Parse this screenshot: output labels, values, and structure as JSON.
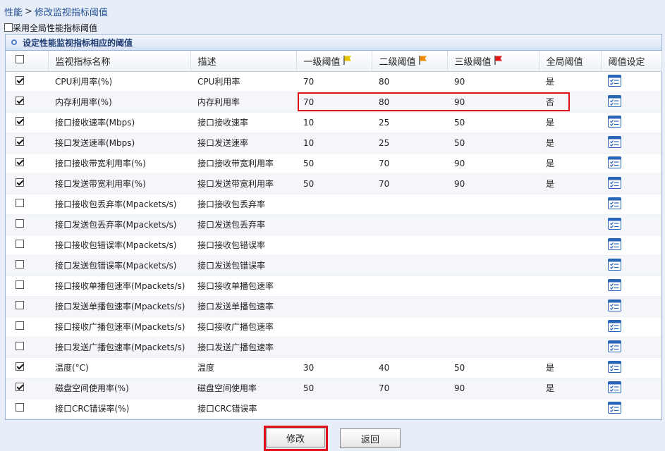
{
  "breadcrumb": {
    "root": "性能",
    "separator": ">",
    "current": "修改监视指标阈值"
  },
  "global_option": {
    "label": "采用全局性能指标阈值",
    "checked": false
  },
  "panel": {
    "title": "设定性能监视指标相应的阈值"
  },
  "table": {
    "headers": {
      "select": "",
      "name": "监视指标名称",
      "desc": "描述",
      "level1": "一级阈值",
      "level2": "二级阈值",
      "level3": "三级阈值",
      "global": "全局阈值",
      "setting": "阈值设定"
    },
    "flag_colors": {
      "level1": "#e8c400",
      "level2": "#f08a00",
      "level3": "#e01818"
    },
    "rows": [
      {
        "checked": true,
        "name": "CPU利用率(%)",
        "desc": "CPU利用率",
        "t1": "70",
        "t2": "80",
        "t3": "90",
        "global": "是"
      },
      {
        "checked": true,
        "name": "内存利用率(%)",
        "desc": "内存利用率",
        "t1": "70",
        "t2": "80",
        "t3": "90",
        "global": "否"
      },
      {
        "checked": true,
        "name": "接口接收速率(Mbps)",
        "desc": "接口接收速率",
        "t1": "10",
        "t2": "25",
        "t3": "50",
        "global": "是"
      },
      {
        "checked": true,
        "name": "接口发送速率(Mbps)",
        "desc": "接口发送速率",
        "t1": "10",
        "t2": "25",
        "t3": "50",
        "global": "是"
      },
      {
        "checked": true,
        "name": "接口接收带宽利用率(%)",
        "desc": "接口接收带宽利用率",
        "t1": "50",
        "t2": "70",
        "t3": "90",
        "global": "是"
      },
      {
        "checked": true,
        "name": "接口发送带宽利用率(%)",
        "desc": "接口发送带宽利用率",
        "t1": "50",
        "t2": "70",
        "t3": "90",
        "global": "是"
      },
      {
        "checked": false,
        "name": "接口接收包丢弃率(Mpackets/s)",
        "desc": "接口接收包丢弃率",
        "t1": "",
        "t2": "",
        "t3": "",
        "global": ""
      },
      {
        "checked": false,
        "name": "接口发送包丢弃率(Mpackets/s)",
        "desc": "接口发送包丢弃率",
        "t1": "",
        "t2": "",
        "t3": "",
        "global": ""
      },
      {
        "checked": false,
        "name": "接口接收包错误率(Mpackets/s)",
        "desc": "接口接收包错误率",
        "t1": "",
        "t2": "",
        "t3": "",
        "global": ""
      },
      {
        "checked": false,
        "name": "接口发送包错误率(Mpackets/s)",
        "desc": "接口发送包错误率",
        "t1": "",
        "t2": "",
        "t3": "",
        "global": ""
      },
      {
        "checked": false,
        "name": "接口接收单播包速率(Mpackets/s)",
        "desc": "接口接收单播包速率",
        "t1": "",
        "t2": "",
        "t3": "",
        "global": ""
      },
      {
        "checked": false,
        "name": "接口发送单播包速率(Mpackets/s)",
        "desc": "接口发送单播包速率",
        "t1": "",
        "t2": "",
        "t3": "",
        "global": ""
      },
      {
        "checked": false,
        "name": "接口接收广播包速率(Mpackets/s)",
        "desc": "接口接收广播包速率",
        "t1": "",
        "t2": "",
        "t3": "",
        "global": ""
      },
      {
        "checked": false,
        "name": "接口发送广播包速率(Mpackets/s)",
        "desc": "接口发送广播包速率",
        "t1": "",
        "t2": "",
        "t3": "",
        "global": ""
      },
      {
        "checked": true,
        "name": "温度(°C)",
        "desc": "温度",
        "t1": "30",
        "t2": "40",
        "t3": "50",
        "global": "是"
      },
      {
        "checked": true,
        "name": "磁盘空间使用率(%)",
        "desc": "磁盘空间使用率",
        "t1": "50",
        "t2": "70",
        "t3": "90",
        "global": "是"
      },
      {
        "checked": false,
        "name": "接口CRC错误率(%)",
        "desc": "接口CRC错误率",
        "t1": "",
        "t2": "",
        "t3": "",
        "global": ""
      }
    ]
  },
  "buttons": {
    "modify": "修改",
    "back": "返回"
  }
}
